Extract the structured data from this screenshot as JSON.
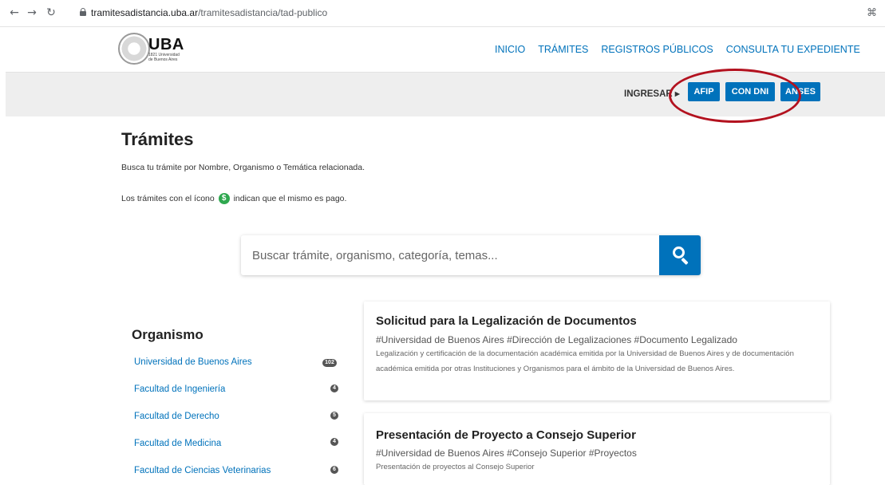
{
  "browser": {
    "url_host": "tramitesadistancia.uba.ar",
    "url_path": "/tramitesadistancia/tad-publico",
    "back_icon": "arrow-left",
    "forward_icon": "arrow-right",
    "reload_icon": "reload",
    "extension_icon": "command-key"
  },
  "header": {
    "logo_text": "UBA",
    "logo_sub": "1821 Universidad de Buenos Aires",
    "nav": [
      "INICIO",
      "TRÁMITES",
      "REGISTROS PÚBLICOS",
      "CONSULTA TU EXPEDIENTE"
    ]
  },
  "login": {
    "label": "INGRESAR",
    "arrow": "▸",
    "buttons": [
      "AFIP",
      "CON DNI",
      "ANSES"
    ],
    "highlight_color": "#b3121f"
  },
  "main": {
    "title": "Trámites",
    "intro": "Busca tu trámite por Nombre, Organismo o Temática relacionada.",
    "pay_note_before": "Los trámites con el ícono",
    "pay_icon": "$",
    "pay_note_after": "indican que el mismo es pago."
  },
  "search": {
    "placeholder": "Buscar trámite, organismo, categoría, temas...",
    "value": ""
  },
  "sidebar": {
    "title": "Organismo",
    "items": [
      {
        "label": "Universidad de Buenos Aires",
        "count": "102"
      },
      {
        "label": "Facultad de Ingeniería",
        "count": "4"
      },
      {
        "label": "Facultad de Derecho",
        "count": "5"
      },
      {
        "label": "Facultad de Medicina",
        "count": "4"
      },
      {
        "label": "Facultad de Ciencias Veterinarias",
        "count": "6"
      }
    ]
  },
  "results": [
    {
      "title": "Solicitud para la Legalización de Documentos",
      "tags": "#Universidad de Buenos Aires #Dirección de Legalizaciones #Documento Legalizado",
      "description": "Legalización y certificación de la documentación académica emitida por la Universidad de Buenos Aires y de documentación académica emitida por otras Instituciones y Organismos para el ámbito de la Universidad de Buenos Aires."
    },
    {
      "title": "Presentación de Proyecto a Consejo Superior",
      "tags": "#Universidad de Buenos Aires #Consejo Superior #Proyectos",
      "description": "Presentación de proyectos al Consejo Superior"
    }
  ],
  "colors": {
    "accent": "#0072bb",
    "pay_green": "#2fa84f",
    "login_bar": "#eeeeee"
  }
}
